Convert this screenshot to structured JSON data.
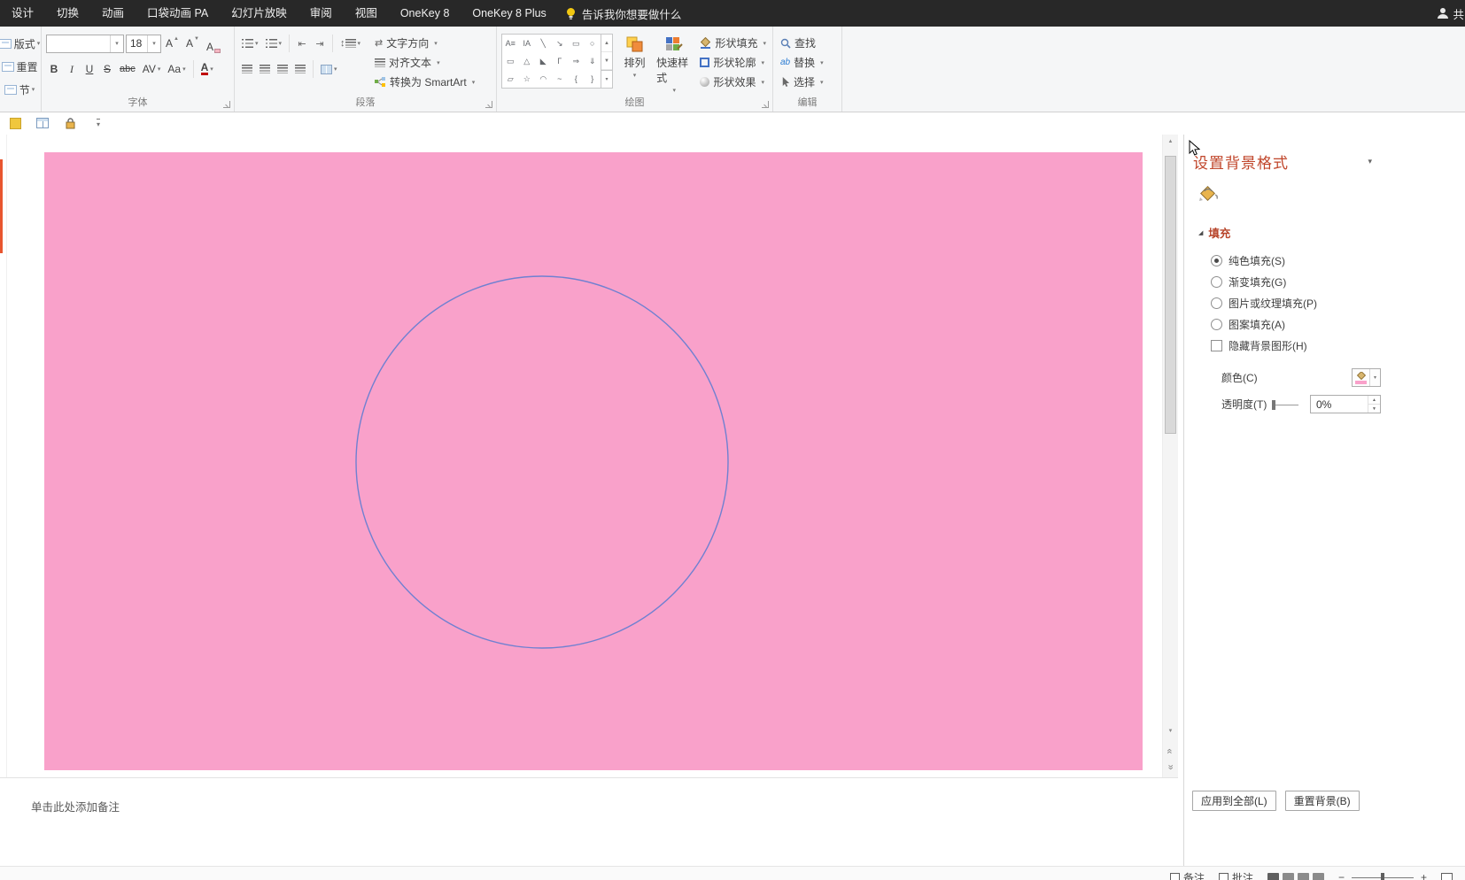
{
  "colors": {
    "accent_title": "#c0452a",
    "slide_pink": "#f9a1ca",
    "circle_stroke": "#6f80d1",
    "titlebar_bg": "#282828",
    "selection_orange": "#e8552f"
  },
  "menubar": {
    "tabs": [
      "设计",
      "切换",
      "动画",
      "口袋动画 PA",
      "幻灯片放映",
      "审阅",
      "视图",
      "OneKey 8",
      "OneKey 8 Plus"
    ],
    "tellme": "告诉我你想要做什么",
    "share": "共"
  },
  "icons": {
    "chevron": "▾",
    "up": "▲",
    "down": "▼",
    "angle": "»",
    "expand_tri": "◢",
    "indent_dec": "⇤",
    "indent_inc": "⇥",
    "line_spacing": "↕",
    "text_dir": "⇄",
    "replace_ab": "ab",
    "zoom_in": "+",
    "zoom_out": "−"
  },
  "ribbon": {
    "left": [
      "版式",
      "重置",
      "节"
    ],
    "labels": {
      "font": "字体",
      "para": "段落",
      "draw": "绘图",
      "edit": "编辑"
    },
    "font": {
      "name_value": "",
      "size_value": "18",
      "grow": "A",
      "shrink": "A",
      "bold": "B",
      "italic": "I",
      "underline": "U",
      "strike": "S",
      "clear": "abc",
      "spacing": "AV",
      "case": "Aa",
      "color": "A"
    },
    "para": {
      "direction": "文字方向",
      "align_text": "对齐文本",
      "smartart": "转换为 SmartArt"
    },
    "draw": {
      "arrange": "排列",
      "quick_styles": "快速样式",
      "shape_fill": "形状填充",
      "shape_outline": "形状轮廓",
      "shape_effects": "形状效果"
    },
    "edit": {
      "find": "查找",
      "replace": "替换",
      "select": "选择"
    },
    "shapes": [
      [
        "A≡",
        "IA",
        "╲",
        "↘",
        "▭",
        "○"
      ],
      [
        "▭",
        "△",
        "◣",
        "Γ",
        "⇒",
        "⇓"
      ],
      [
        "▱",
        "☆",
        "◠",
        "~",
        "{",
        "}"
      ]
    ]
  },
  "slide": {
    "bg": "#f9a1ca",
    "circle_stroke": "#6f80d1"
  },
  "pane": {
    "title": "设置背景格式",
    "fill_header": "填充",
    "options": [
      {
        "label": "纯色填充(S)",
        "checked": true
      },
      {
        "label": "渐变填充(G)",
        "checked": false
      },
      {
        "label": "图片或纹理填充(P)",
        "checked": false
      },
      {
        "label": "图案填充(A)",
        "checked": false
      }
    ],
    "hide_bg": "隐藏背景图形(H)",
    "color_label": "颜色(C)",
    "transparency_label": "透明度(T)",
    "transparency_value": "0%",
    "apply_all": "应用到全部(L)",
    "reset_bg": "重置背景(B)"
  },
  "notes": {
    "placeholder": "单击此处添加备注"
  },
  "status": {
    "notes_btn": "备注",
    "comments_btn": "批注"
  }
}
